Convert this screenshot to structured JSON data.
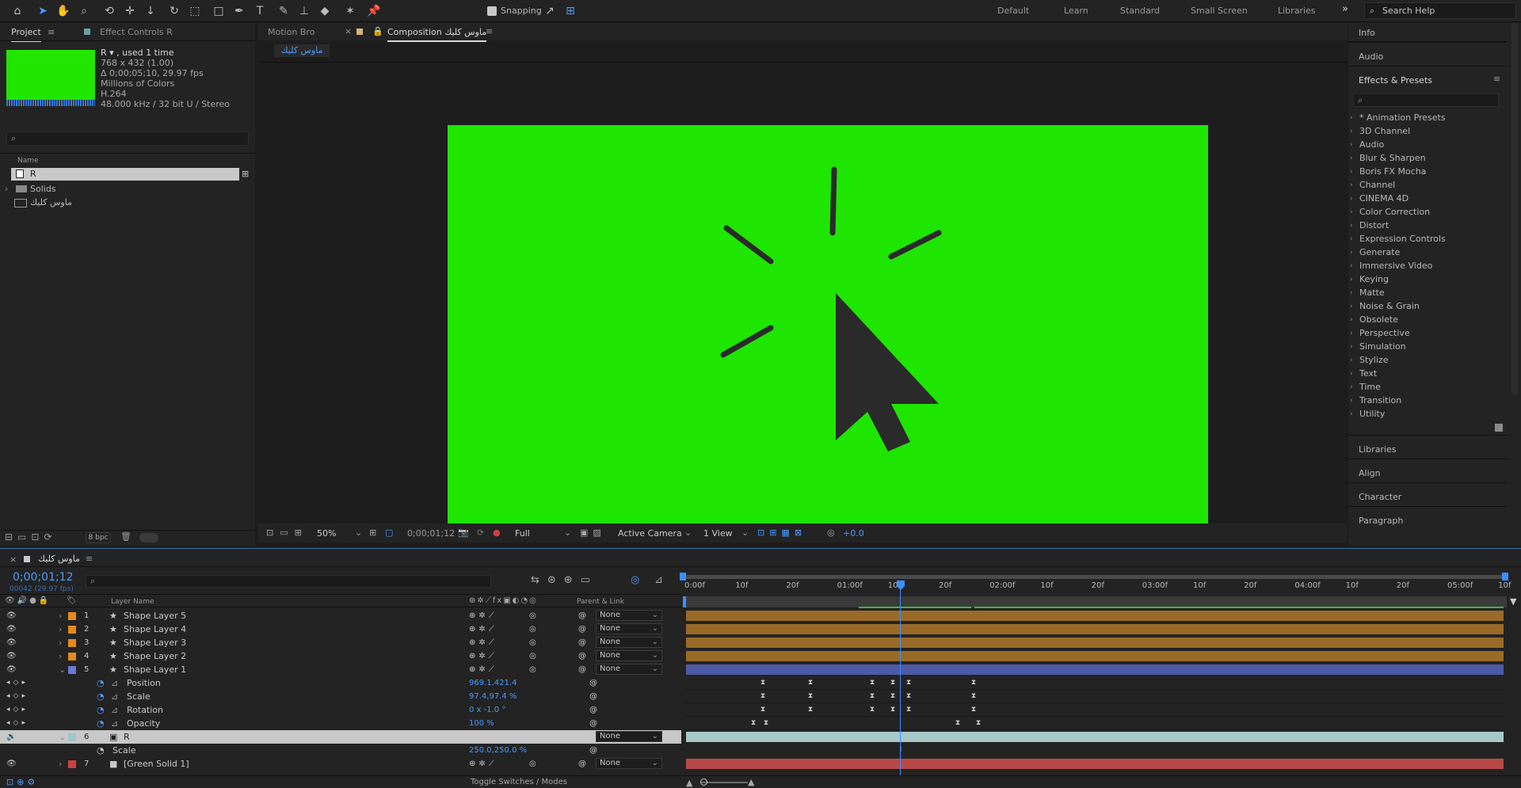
{
  "toolbar": {
    "snapping_label": "Snapping",
    "workspaces": [
      "Default",
      "Learn",
      "Standard",
      "Small Screen",
      "Libraries"
    ],
    "search_placeholder": "Search Help"
  },
  "project_panel": {
    "tab_project": "Project",
    "tab_effect_controls": "Effect Controls R",
    "item_name": "R",
    "item_used": ", used 1 time",
    "item_size": "768 x 432 (1.00)",
    "item_duration": "Δ 0;00;05;10, 29.97 fps",
    "item_colors": "Millions of Colors",
    "item_codec": "H.264",
    "item_audio": "48.000 kHz / 32 bit U / Stereo",
    "column_name": "Name",
    "rows": [
      "R",
      "Solids",
      "ماوس كليك"
    ],
    "bpc": "8 bpc"
  },
  "comp_panel": {
    "tab_motion_bro": "Motion Bro",
    "tab_composition": "Composition ماوس كليك",
    "sub_tab": "ماوس كليك",
    "zoom": "50%",
    "timecode": "0;00;01;12",
    "resolution": "Full",
    "camera": "Active Camera",
    "view": "1 View",
    "exposure": "+0.0"
  },
  "right_panels": {
    "info": "Info",
    "audio": "Audio",
    "effects_presets": "Effects & Presets",
    "categories": [
      "* Animation Presets",
      "3D Channel",
      "Audio",
      "Blur & Sharpen",
      "Boris FX Mocha",
      "Channel",
      "CINEMA 4D",
      "Color Correction",
      "Distort",
      "Expression Controls",
      "Generate",
      "Immersive Video",
      "Keying",
      "Matte",
      "Noise & Grain",
      "Obsolete",
      "Perspective",
      "Simulation",
      "Stylize",
      "Text",
      "Time",
      "Transition",
      "Utility"
    ],
    "libraries": "Libraries",
    "align": "Align",
    "character": "Character",
    "paragraph": "Paragraph"
  },
  "timeline": {
    "comp_name": "ماوس كليك",
    "timecode": "0;00;01;12",
    "frames": "00042 (29.97 fps)",
    "col_layer_name": "Layer Name",
    "col_parent": "Parent & Link",
    "ruler": [
      "0:00f",
      "10f",
      "20f",
      "01:00f",
      "10f",
      "20f",
      "02:00f",
      "10f",
      "20f",
      "03:00f",
      "10f",
      "20f",
      "04:00f",
      "10f",
      "20f",
      "05:00f",
      "10f"
    ],
    "layers": [
      {
        "num": "1",
        "name": "Shape Layer 5",
        "parent": "None"
      },
      {
        "num": "2",
        "name": "Shape Layer 4",
        "parent": "None"
      },
      {
        "num": "3",
        "name": "Shape Layer 3",
        "parent": "None"
      },
      {
        "num": "4",
        "name": "Shape Layer 2",
        "parent": "None"
      },
      {
        "num": "5",
        "name": "Shape Layer 1",
        "parent": "None"
      }
    ],
    "props": [
      {
        "name": "Position",
        "value": "969.1,421.4"
      },
      {
        "name": "Scale",
        "value": "97.4,97.4 %"
      },
      {
        "name": "Rotation",
        "value": "0 x -1.0 °"
      },
      {
        "name": "Opacity",
        "value": "100 %"
      }
    ],
    "layer6": {
      "num": "6",
      "name": "R",
      "parent": "None",
      "prop": "Scale",
      "value": "250.0,250.0 %"
    },
    "layer7": {
      "num": "7",
      "name": "[Green Solid 1]",
      "parent": "None"
    },
    "toggle_label": "Toggle Switches / Modes"
  }
}
